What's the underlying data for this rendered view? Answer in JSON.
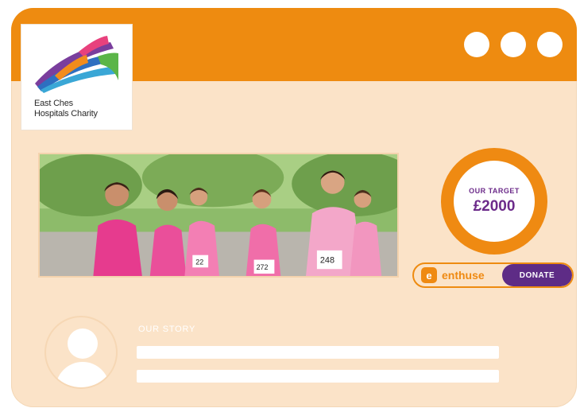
{
  "logo": {
    "line1": "East Ches",
    "line2": "Hospitals Charity",
    "colors": [
      "#7a3e9d",
      "#2e6fc0",
      "#3aa7d6",
      "#e8417d",
      "#f28c1c",
      "#5bb548"
    ]
  },
  "window": {
    "controls": [
      "dot",
      "dot",
      "dot"
    ],
    "accent": "#ee8b10",
    "background": "#fbe3c8"
  },
  "photo": {
    "bibs": [
      "22",
      "272",
      "248"
    ]
  },
  "target": {
    "label": "OUR TARGET",
    "amount": "£2000"
  },
  "donate": {
    "provider": "enthuse",
    "button_label": "DONATE",
    "accent": "#5e2c86"
  },
  "story": {
    "label": "OUR STORY"
  }
}
